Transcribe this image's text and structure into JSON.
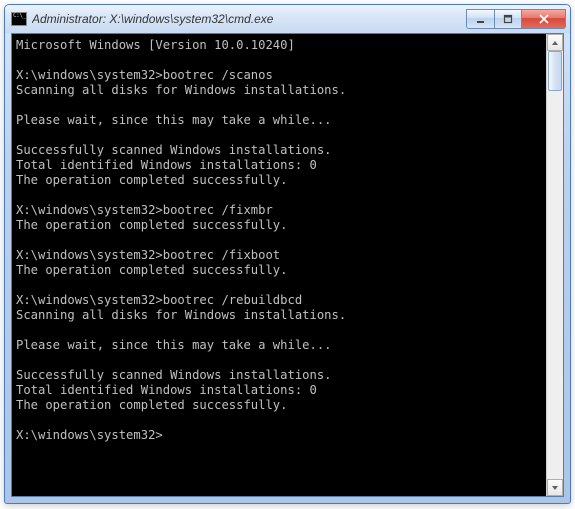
{
  "window": {
    "title": "Administrator: X:\\windows\\system32\\cmd.exe"
  },
  "terminal": {
    "lines": [
      "Microsoft Windows [Version 10.0.10240]",
      "",
      "X:\\windows\\system32>bootrec /scanos",
      "Scanning all disks for Windows installations.",
      "",
      "Please wait, since this may take a while...",
      "",
      "Successfully scanned Windows installations.",
      "Total identified Windows installations: 0",
      "The operation completed successfully.",
      "",
      "X:\\windows\\system32>bootrec /fixmbr",
      "The operation completed successfully.",
      "",
      "X:\\windows\\system32>bootrec /fixboot",
      "The operation completed successfully.",
      "",
      "X:\\windows\\system32>bootrec /rebuildbcd",
      "Scanning all disks for Windows installations.",
      "",
      "Please wait, since this may take a while...",
      "",
      "Successfully scanned Windows installations.",
      "Total identified Windows installations: 0",
      "The operation completed successfully.",
      "",
      "X:\\windows\\system32>"
    ]
  }
}
